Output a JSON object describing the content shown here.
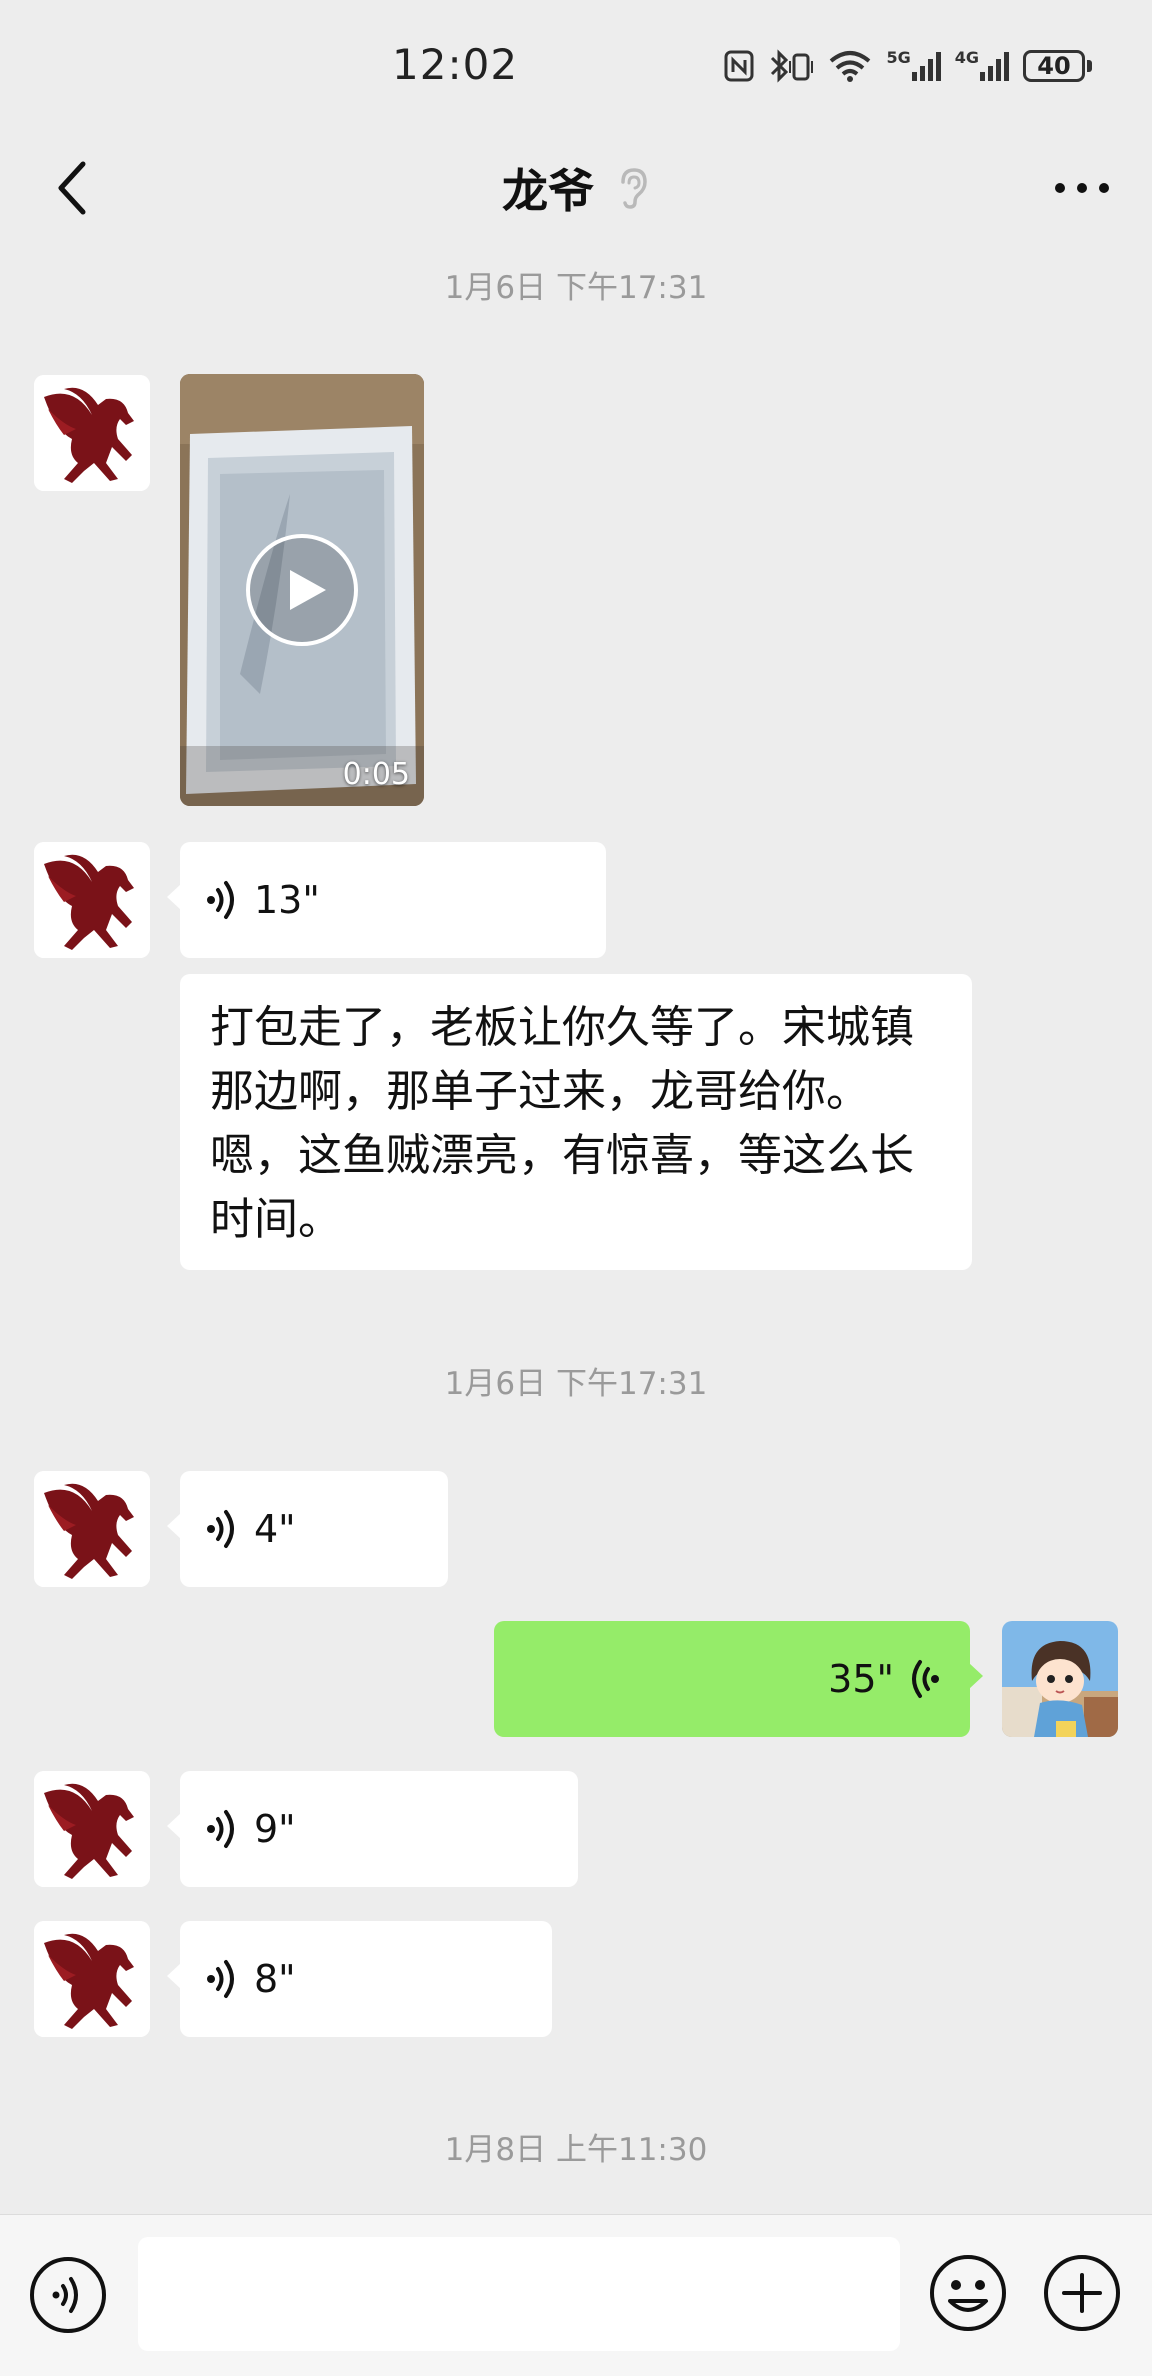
{
  "status_bar": {
    "time": "12:02",
    "network_5g": "5G",
    "network_4g": "4G",
    "battery": "40"
  },
  "header": {
    "title": "龙爷",
    "back_icon": "chevron-left-icon",
    "mute_icon": "ear-icon",
    "more_icon": "more-dots-icon"
  },
  "messages": {
    "timestamp_1": "1月6日 下午17:31",
    "video_duration": "0:05",
    "voice_1_duration": "13\"",
    "transcript_text": "打包走了，老板让你久等了。宋城镇那边啊，那单子过来，龙哥给你。嗯，这鱼贼漂亮，有惊喜，等这么长时间。",
    "timestamp_2": "1月6日 下午17:31",
    "voice_2_duration": "4\"",
    "voice_3_duration": "35\"",
    "voice_4_duration": "9\"",
    "voice_5_duration": "8\"",
    "timestamp_3": "1月8日 上午11:30"
  },
  "input_bar": {
    "message_value": "",
    "voice_icon": "voice-mode-icon",
    "emoji_icon": "emoji-icon",
    "plus_icon": "plus-icon"
  },
  "colors": {
    "background": "#ededed",
    "bubble_other": "#ffffff",
    "bubble_me": "#95ec69"
  }
}
